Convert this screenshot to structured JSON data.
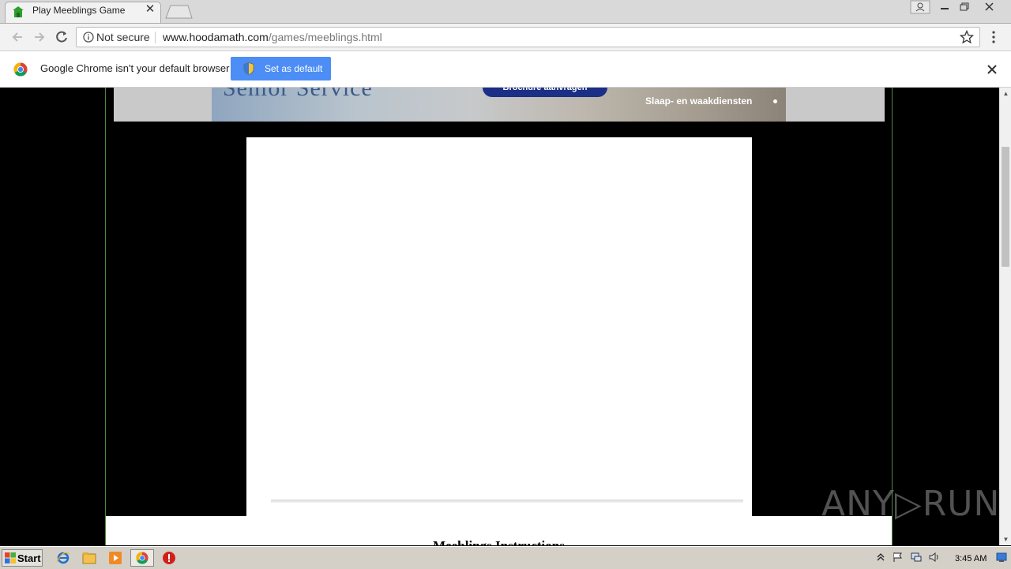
{
  "browser": {
    "tab": {
      "title": "Play Meeblings Game"
    },
    "omnibox": {
      "security_label": "Not secure",
      "url_host": "www.hoodamath.com",
      "url_path": "/games/meeblings.html"
    }
  },
  "infobar": {
    "message": "Google Chrome isn't your default browser",
    "button_label": "Set as default"
  },
  "ad": {
    "brand_text": "Senior Service",
    "cta_label": "Brochure aanvragen",
    "line_text": "Slaap- en waakdiensten"
  },
  "page": {
    "instructions_heading": "Meeblings Instructions"
  },
  "watermark": "ANY▷RUN",
  "taskbar": {
    "start_label": "Start",
    "clock": "3:45 AM"
  },
  "colors": {
    "accent_button": "#4c8df6",
    "page_background": "#000000",
    "column_border": "#4a8a3a"
  }
}
